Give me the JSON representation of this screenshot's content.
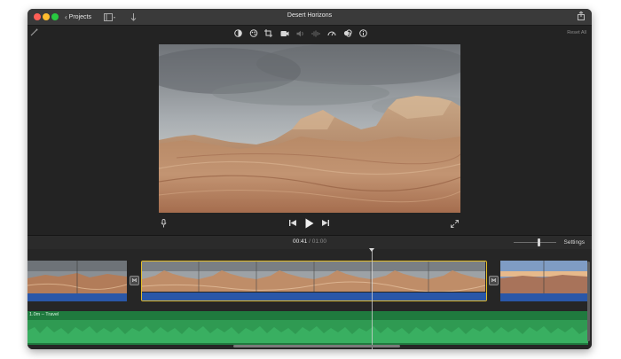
{
  "window": {
    "title": "Desert Horizons",
    "projects_label": "Projects"
  },
  "toolbar": {
    "reset_all_label": "Reset All",
    "tools": [
      "color-balance-icon",
      "color-correction-icon",
      "crop-icon",
      "stabilization-icon",
      "volume-icon",
      "noise-reduction-icon",
      "speed-icon",
      "clip-filter-icon",
      "info-icon"
    ]
  },
  "playback": {
    "current_time": "00:41",
    "separator": "/",
    "total_time": "01:00"
  },
  "timeline": {
    "settings_label": "Settings",
    "music_track_label": "1.0m – Travel"
  },
  "colors": {
    "selection": "#e5be2a",
    "audio_strip": "#2a57a8",
    "music_track": "#1f7a3e",
    "window_bg": "#232323"
  }
}
